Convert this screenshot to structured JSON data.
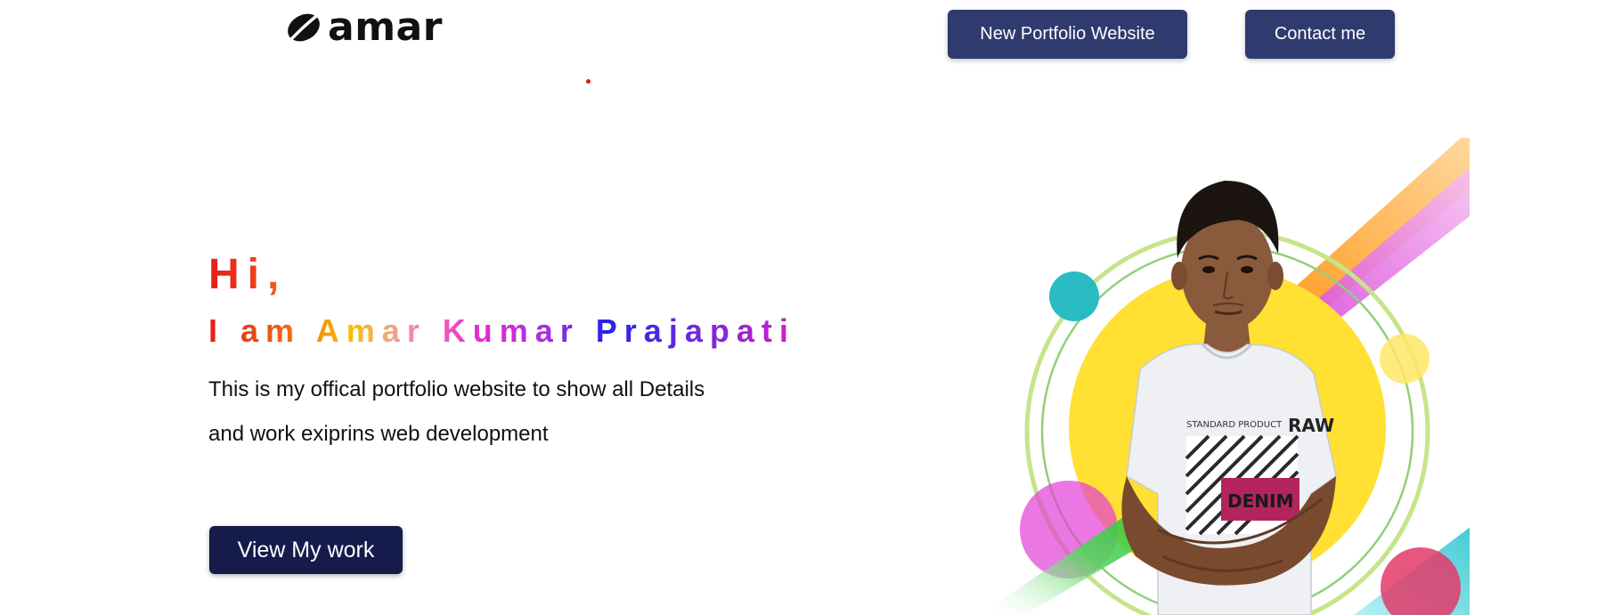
{
  "header": {
    "logo_text": "amar",
    "buttons": {
      "portfolio_label": "New Portfolio Website",
      "contact_label": "Contact me"
    }
  },
  "hero": {
    "greeting": "Hi,",
    "name_line": "I am Amar Kumar Prajapati",
    "description_line1": "This is my offical portfolio website to show all Details",
    "description_line2": "and work exiprins web development",
    "cta_label": "View My work",
    "shirt_text_top": "STANDARD PRODUCT",
    "shirt_text_raw": "RAW",
    "shirt_text_denim": "DENIM"
  },
  "colors": {
    "header_button_bg": "#2f3a6e",
    "cta_button_bg": "#151b4a",
    "greeting_red": "#e81c1c",
    "name_gradient": [
      "#e81c1c",
      "#f06a12",
      "#f5c000",
      "#f09aa0",
      "#e82ad0",
      "#2424e8",
      "#d21ec8"
    ],
    "accent_yellow": "#ffe033",
    "accent_teal": "#1fb8c1",
    "accent_magenta": "#e23fd6",
    "accent_green_ring": "#b8df7a"
  },
  "icons": {
    "logo_mark": "coffee-bean-icon"
  }
}
